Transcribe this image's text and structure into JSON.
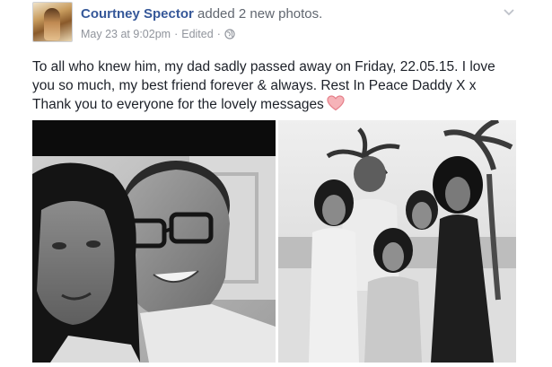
{
  "post": {
    "author": "Courtney Spector",
    "action": " added 2 new photos.",
    "date": "May 23 at 9:02pm",
    "separator": " · ",
    "edited": "Edited",
    "separator_end": " ·",
    "message_lines": [
      "To all who knew him, my dad sadly passed away on Friday, 22.05.15. I love",
      "you so much, my best friend forever & always. Rest In Peace Daddy X x",
      "Thank you to everyone for the lovely messages"
    ],
    "icons": {
      "privacy": "globe-icon",
      "menu": "chevron-down-icon",
      "emoji": "heart-icon"
    },
    "colors": {
      "author_link": "#365899",
      "meta_text": "#90949c",
      "heart": "#f08b94"
    }
  }
}
